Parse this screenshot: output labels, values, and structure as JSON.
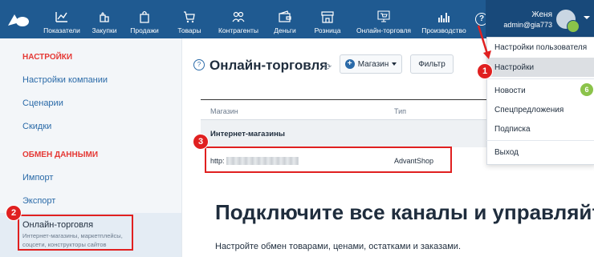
{
  "nav": {
    "items": [
      {
        "label": "Показатели",
        "icon": "chart-line-icon"
      },
      {
        "label": "Закупки",
        "icon": "bags-icon"
      },
      {
        "label": "Продажи",
        "icon": "shopping-bag-icon"
      },
      {
        "label": "Товары",
        "icon": "cart-icon"
      },
      {
        "label": "Контрагенты",
        "icon": "people-icon"
      },
      {
        "label": "Деньги",
        "icon": "wallet-icon"
      },
      {
        "label": "Розница",
        "icon": "store-icon"
      },
      {
        "label": "Онлайн-торговля",
        "icon": "online-store-icon"
      },
      {
        "label": "Производство",
        "icon": "factory-icon"
      }
    ],
    "help": "?"
  },
  "user": {
    "name": "Женя",
    "email": "admin@gia773"
  },
  "sidebar": {
    "section1": "НАСТРОЙКИ",
    "links1": [
      "Настройки компании",
      "Сценарии",
      "Скидки"
    ],
    "section2": "ОБМЕН ДАННЫМИ",
    "links2": [
      "Импорт",
      "Экспорт"
    ],
    "active_title": "Онлайн-торговля",
    "active_desc": "Интернет-магазины, маркетплейсы, соцсети, конструкторы сайтов"
  },
  "page": {
    "title": "Онлайн-торговля",
    "store_button": "Магазин",
    "filter_button": "Фильтр",
    "col_store": "Магазин",
    "col_type": "Тип",
    "group": "Интернет-магазины",
    "row_url": "http:",
    "row_type": "AdvantShop",
    "hero": "Подключите все каналы и управляйте",
    "hero_sub": "Настройте обмен товарами, ценами, остатками и заказами."
  },
  "dropdown": {
    "items": [
      "Настройки пользователя",
      "Настройки",
      "Новости",
      "Спецпредложения",
      "Подписка",
      "Выход"
    ],
    "news_count": "6"
  },
  "annotations": {
    "badge1": "1",
    "badge2": "2",
    "badge3": "3"
  },
  "colors": {
    "topbar": "#1f5a91",
    "accent_red": "#e02020",
    "link": "#2a6aa8"
  }
}
